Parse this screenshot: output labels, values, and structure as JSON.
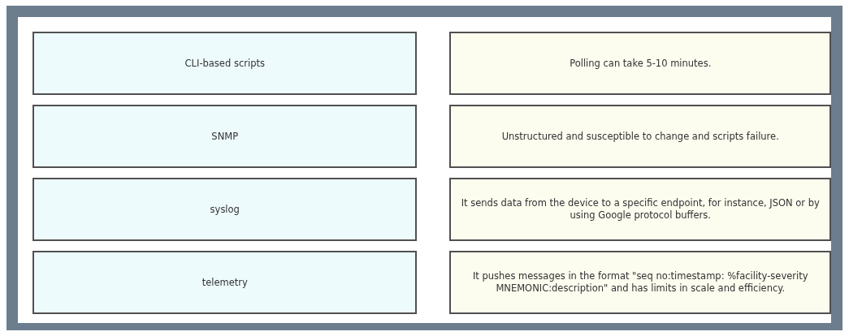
{
  "terms": [
    {
      "label": "CLI-based scripts"
    },
    {
      "label": "SNMP"
    },
    {
      "label": "syslog"
    },
    {
      "label": "telemetry"
    }
  ],
  "descriptions": [
    {
      "label": "Polling can take 5-10 minutes."
    },
    {
      "label": "Unstructured and susceptible to change and scripts failure."
    },
    {
      "label": "It sends data from the device to a specific endpoint, for instance, JSON or by using Google protocol buffers."
    },
    {
      "label": "It pushes messages in the format \"seq no:timestamp: %facility-severity MNEMONIC:description\" and has limits in scale and efficiency."
    }
  ]
}
